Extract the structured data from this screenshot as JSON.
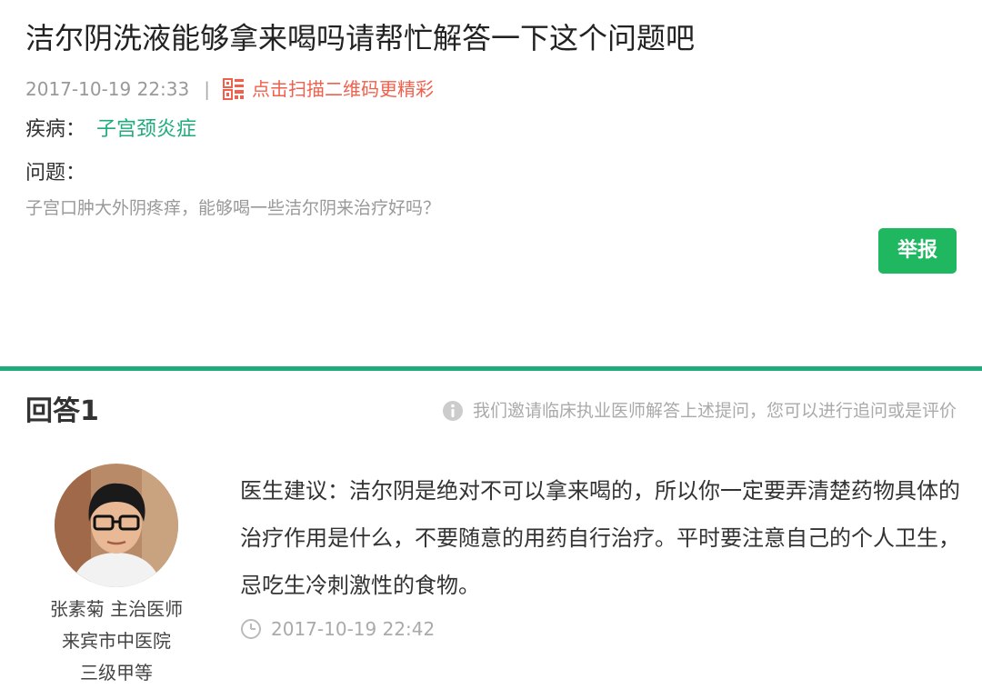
{
  "question": {
    "title": "洁尔阴洗液能够拿来喝吗请帮忙解答一下这个问题吧",
    "date": "2017-10-19 22:33",
    "separator": "|",
    "qr_link_label": "点击扫描二维码更精彩",
    "disease_label": "疾病：",
    "disease_value": "子宫颈炎症",
    "question_label": "问题：",
    "question_text": "子宫口肿大外阴疼痒，能够喝一些洁尔阴来治疗好吗？",
    "report_label": "举报"
  },
  "answer": {
    "heading": "回答1",
    "note": "我们邀请临床执业医师解答上述提问，您可以进行追问或是评价",
    "doctor": {
      "name_title": "张素菊 主治医师",
      "hospital": "来宾市中医院",
      "level": "三级甲等"
    },
    "text": "医生建议：洁尔阴是绝对不可以拿来喝的，所以你一定要弄清楚药物具体的治疗作用是什么，不要随意的用药自行治疗。平时要注意自己的个人卫生，忌吃生冷刺激性的食物。",
    "time": "2017-10-19 22:42"
  },
  "colors": {
    "accent_green": "#1fab7c",
    "button_green": "#1fb860",
    "qr_red": "#f0604d",
    "muted_gray": "#999999"
  },
  "icons": {
    "qr": "qr-code-icon",
    "info": "info-icon",
    "clock": "clock-icon"
  }
}
